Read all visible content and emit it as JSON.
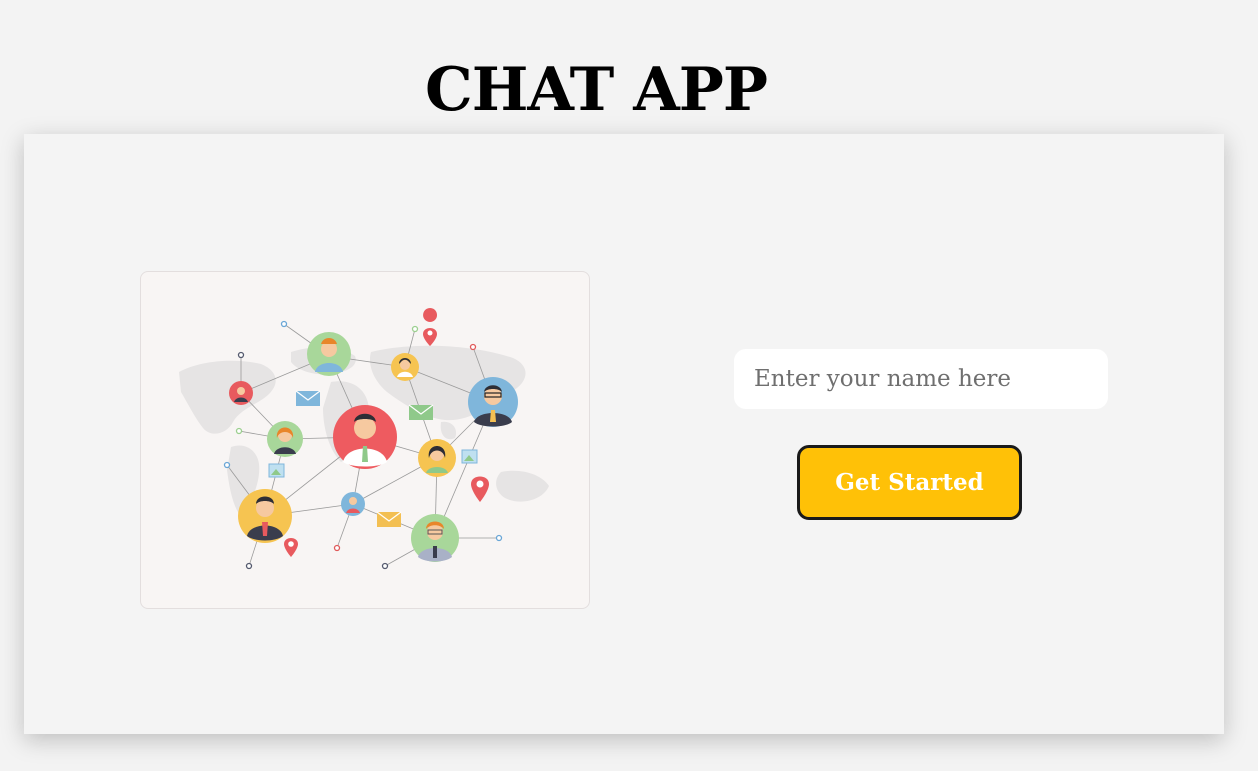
{
  "app": {
    "title": "CHAT APP"
  },
  "form": {
    "name_placeholder": "Enter your name here",
    "name_value": "",
    "submit_label": "Get Started"
  },
  "colors": {
    "background": "#f3f3f3",
    "card": "#f4f4f4",
    "button": "#ffc107",
    "button_text": "#ffffff",
    "illustration_bg": "#f8f5f4"
  },
  "illustration": {
    "subject": "social-network-people-icons"
  }
}
